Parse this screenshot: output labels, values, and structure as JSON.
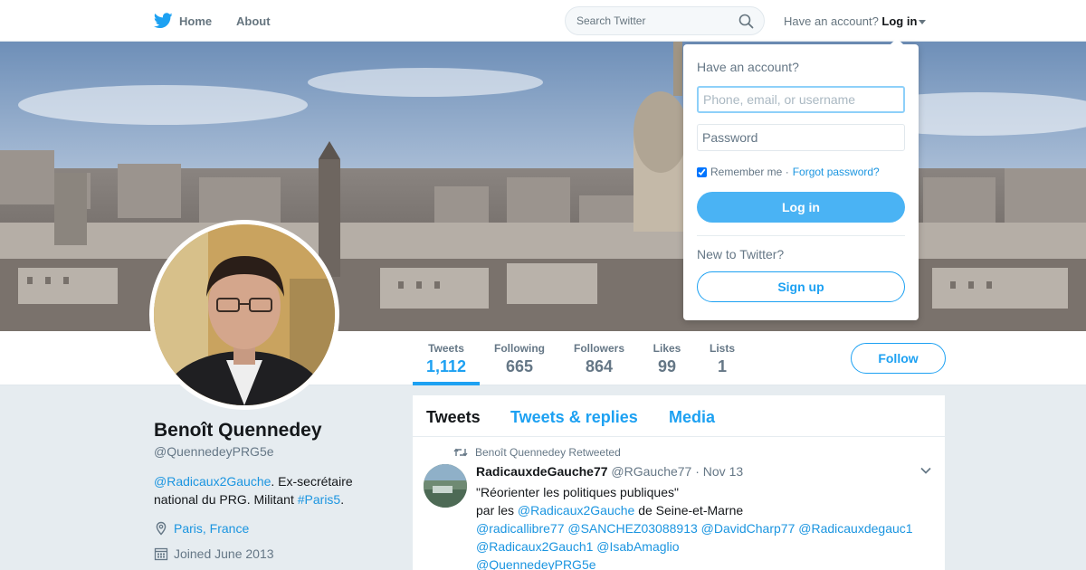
{
  "nav": {
    "home_label": "Home",
    "about_label": "About",
    "search_placeholder": "Search Twitter",
    "have_account": "Have an account?",
    "login_label": "Log in"
  },
  "profile": {
    "name": "Benoît Quennedey",
    "handle": "@QuennedeyPRG5e",
    "bio_mention": "@Radicaux2Gauche",
    "bio_text": ". Ex-secrétaire national du PRG. Militant ",
    "bio_hashtag": "#Paris5",
    "bio_end": ".",
    "location": "Paris, France",
    "joined": "Joined June 2013"
  },
  "stats": [
    {
      "label": "Tweets",
      "value": "1,112"
    },
    {
      "label": "Following",
      "value": "665"
    },
    {
      "label": "Followers",
      "value": "864"
    },
    {
      "label": "Likes",
      "value": "99"
    },
    {
      "label": "Lists",
      "value": "1"
    }
  ],
  "follow_label": "Follow",
  "tabs": [
    "Tweets",
    "Tweets & replies",
    "Media"
  ],
  "tweet": {
    "retweeted_by": "Benoît Quennedey Retweeted",
    "name": "RadicauxdeGauche77",
    "handle": "@RGauche77",
    "date": "· Nov 13",
    "line1": "\"Réorienter les politiques publiques\"",
    "line2_pre": "par les ",
    "line2_mention": "@Radicaux2Gauche",
    "line2_post": " de Seine-et-Marne",
    "mentions_line1": "@radicallibre77 @SANCHEZ03088913 @DavidCharp77 @Radicauxdegauc1",
    "mentions_line2": "@Radicaux2Gauch1 @IsabAmaglio",
    "mentions_line3": "@QuennedeyPRG5e"
  },
  "login_dropdown": {
    "title": "Have an account?",
    "username_placeholder": "Phone, email, or username",
    "password_placeholder": "Password",
    "remember_label": "Remember me ·",
    "forgot_label": "Forgot password?",
    "login_button": "Log in",
    "new_label": "New to Twitter?",
    "signup_button": "Sign up"
  },
  "colors": {
    "accent": "#1da1f2",
    "link": "#1b95e0",
    "login_button": "#4ab3f4",
    "background": "#e6ecf0"
  },
  "icons": [
    "twitter-bird-icon",
    "search-icon",
    "caret-down-icon",
    "location-pin-icon",
    "calendar-icon",
    "retweet-icon",
    "chevron-down-icon"
  ]
}
